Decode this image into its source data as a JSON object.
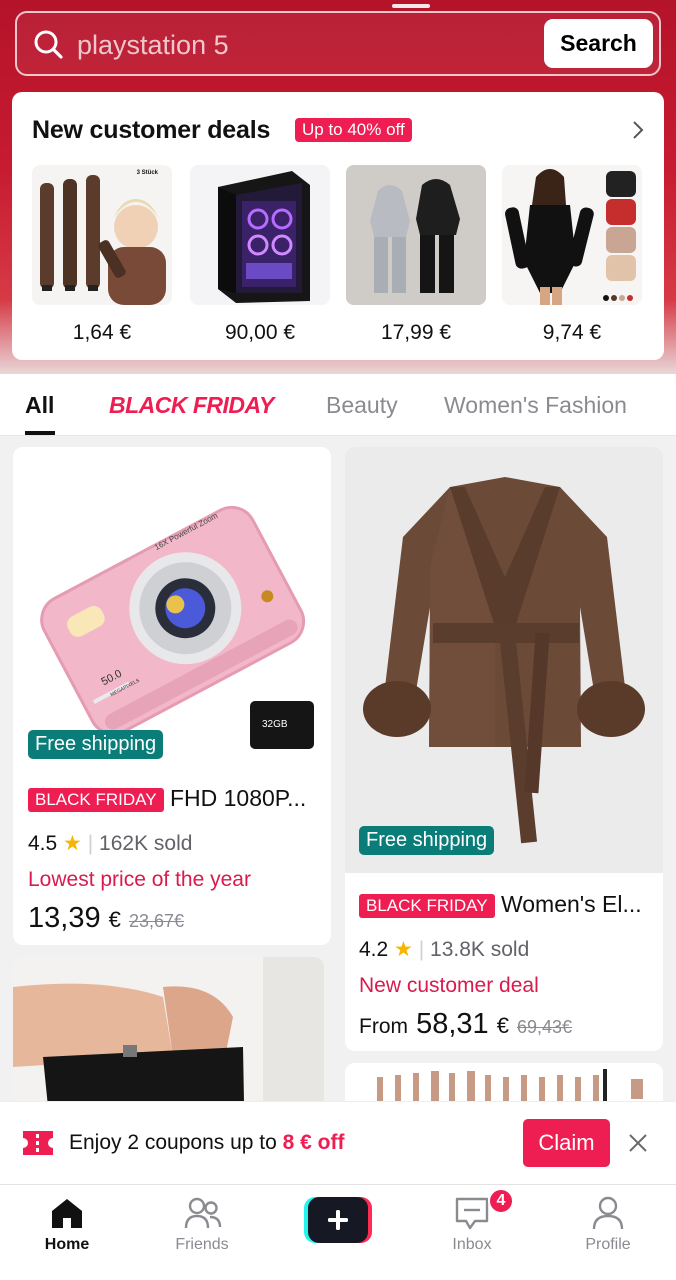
{
  "search": {
    "query": "playstation 5",
    "button_label": "Search"
  },
  "deals": {
    "title": "New customer deals",
    "badge": "Up to 40% off",
    "items": [
      {
        "price": "1,64 €",
        "tag": "3 Stück"
      },
      {
        "price": "90,00 €"
      },
      {
        "price": "17,99 €"
      },
      {
        "price": "9,74 €"
      }
    ]
  },
  "tabs": [
    "All",
    "BLACK FRIDAY",
    "Beauty",
    "Women's Fashion"
  ],
  "products": [
    {
      "shipping": "Free shipping",
      "tag": "BLACK FRIDAY",
      "title": "FHD 1080P...",
      "rating": "4.5",
      "sold": "162K sold",
      "promo": "Lowest price of the year",
      "price_prefix": "",
      "price": "13,39",
      "currency": "€",
      "old_price": "23,67€",
      "image_text": {
        "zoom": "16X Powerful Zoom",
        "mp": "50.0",
        "mp_unit": "MEGAPIXELS",
        "card": "32GB"
      }
    },
    {
      "shipping": "Free shipping",
      "tag": "BLACK FRIDAY",
      "title": "Women's El...",
      "rating": "4.2",
      "sold": "13.8K sold",
      "promo": "New customer deal",
      "price_prefix": "From",
      "price": "58,31",
      "currency": "€",
      "old_price": "69,43€"
    }
  ],
  "coupon": {
    "prefix": "Enjoy 2 coupons up to ",
    "amount": "8 € off",
    "claim_label": "Claim"
  },
  "nav": {
    "items": [
      {
        "label": "Home",
        "icon": "home-icon"
      },
      {
        "label": "Friends",
        "icon": "friends-icon"
      },
      {
        "label": "",
        "icon": "plus-icon"
      },
      {
        "label": "Inbox",
        "icon": "inbox-icon"
      },
      {
        "label": "Profile",
        "icon": "profile-icon"
      }
    ],
    "inbox_badge": "4"
  },
  "colors": {
    "brand": "#ee1d52",
    "hero": "#c71b30",
    "shipping": "#0a7d79"
  }
}
